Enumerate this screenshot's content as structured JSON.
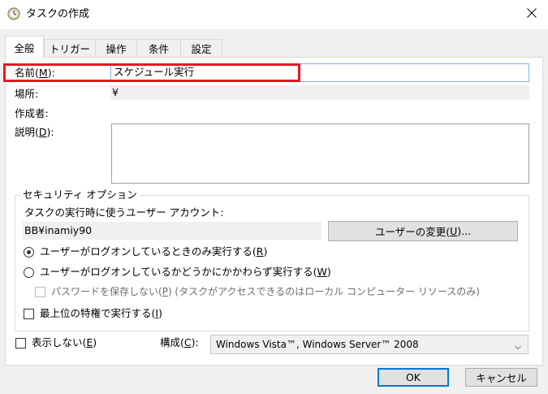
{
  "window": {
    "title": "タスクの作成",
    "icon": "task-clock-icon",
    "close_icon": "close-icon"
  },
  "tabs": [
    {
      "label": "全般",
      "active": true
    },
    {
      "label": "トリガー"
    },
    {
      "label": "操作"
    },
    {
      "label": "条件"
    },
    {
      "label": "設定"
    }
  ],
  "general": {
    "name_label": "名前(",
    "name_mnemonic": "M",
    "name_label_end": "):",
    "name_value": "スケジュール実行",
    "location_label": "場所:",
    "location_value": "¥",
    "author_label": "作成者:",
    "description_label": "説明(",
    "description_mnemonic": "D",
    "description_label_end": "):"
  },
  "security": {
    "group_title": "セキュリティ オプション",
    "account_prompt": "タスクの実行時に使うユーザー アカウント:",
    "account_value": "BB¥inamiy90",
    "change_user_button": "ユーザーの変更(",
    "change_user_mnemonic": "U",
    "change_user_end": ")...",
    "radio_logged_on": "ユーザーがログオンしているときのみ実行する(",
    "radio_logged_on_mnemonic": "R",
    "radio_logged_on_end": ")",
    "radio_logged_on_selected": true,
    "radio_whether": "ユーザーがログオンしているかどうかにかかわらず実行する(",
    "radio_whether_mnemonic": "W",
    "radio_whether_end": ")",
    "no_password_label": "パスワードを保存しない(",
    "no_password_mnemonic": "P",
    "no_password_end": ") (タスクがアクセスできるのはローカル コンピューター リソースのみ)",
    "highest_priv_label": "最上位の特権で実行する(",
    "highest_priv_mnemonic": "I",
    "highest_priv_end": ")"
  },
  "footer": {
    "hidden_label": "表示しない(",
    "hidden_mnemonic": "E",
    "hidden_end": ")",
    "configure_label": "構成(",
    "configure_mnemonic": "C",
    "configure_end": "):",
    "configure_value": "Windows Vista™, Windows Server™ 2008",
    "ok_button": "OK",
    "cancel_button": "キャンセル"
  },
  "colors": {
    "highlight": "#e21a22",
    "accent": "#0078d7"
  }
}
